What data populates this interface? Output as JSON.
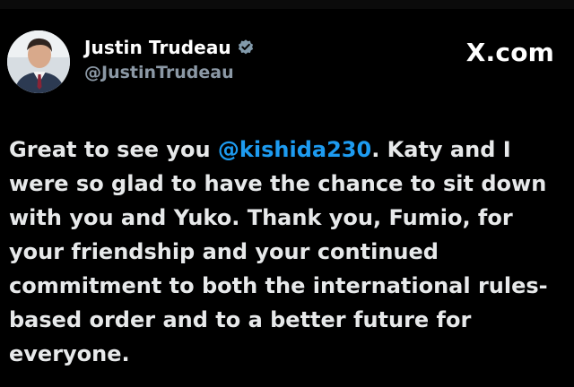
{
  "author": {
    "display_name": "Justin Trudeau",
    "handle": "@JustinTrudeau",
    "verified": true,
    "avatar_icon": "profile-photo-avatar"
  },
  "brand": {
    "label": "X.com",
    "icon": "x-logo-icon"
  },
  "tweet": {
    "text_before_mention": "Great to see you ",
    "mention": "@kishida230",
    "text_after_mention": ". Katy and I were so glad to have the chance to sit down with you and Yuko. Thank you, Fumio, for your friendship and your continued commitment to both the international rules-based order and to a better future for everyone."
  },
  "colors": {
    "background": "#000000",
    "text": "#e7e9ea",
    "handle": "#8b98a5",
    "mention": "#1d9bf0",
    "verified_badge": "#829aab"
  }
}
